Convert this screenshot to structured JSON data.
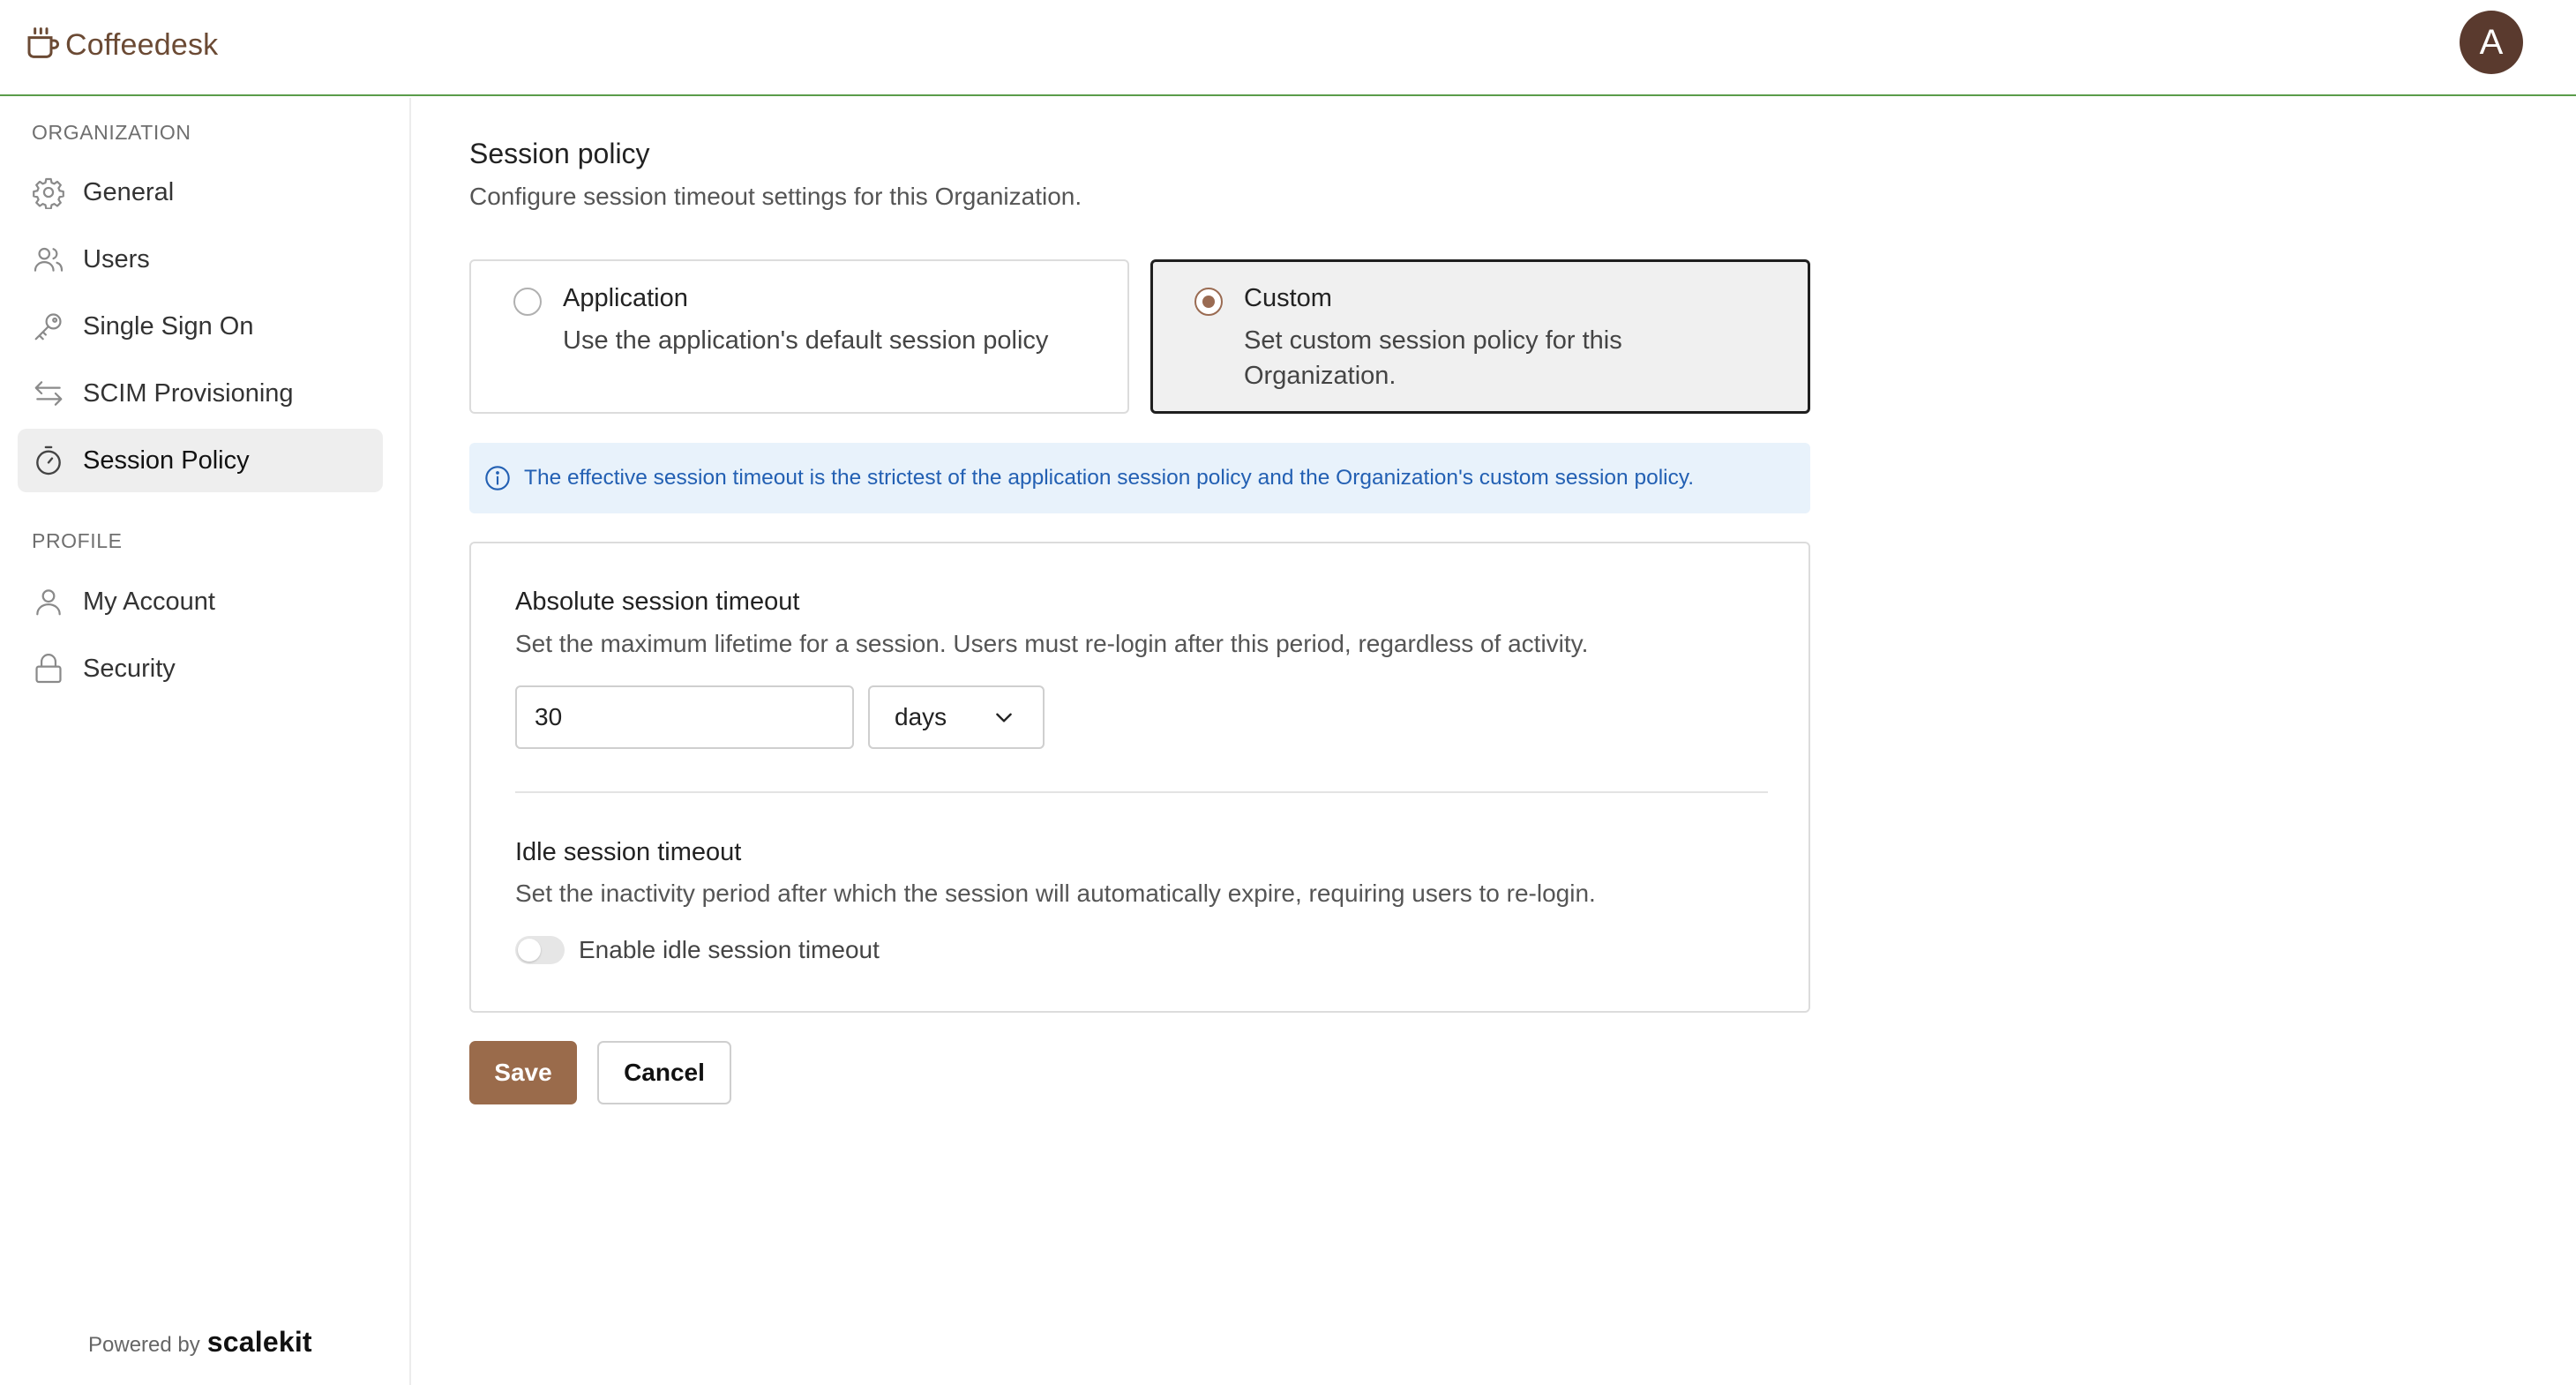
{
  "header": {
    "brand_name": "Coffeedesk",
    "brand_icon": "coffee-cup-icon",
    "avatar_initial": "A"
  },
  "sidebar": {
    "organization_label": "ORGANIZATION",
    "organization_items": [
      {
        "label": "General",
        "icon": "gear-icon"
      },
      {
        "label": "Users",
        "icon": "users-icon"
      },
      {
        "label": "Single Sign On",
        "icon": "key-icon"
      },
      {
        "label": "SCIM Provisioning",
        "icon": "arrows-exchange-icon"
      },
      {
        "label": "Session Policy",
        "icon": "stopwatch-icon",
        "active": true
      }
    ],
    "profile_label": "PROFILE",
    "profile_items": [
      {
        "label": "My Account",
        "icon": "user-icon"
      },
      {
        "label": "Security",
        "icon": "lock-icon"
      }
    ],
    "powered_by": "Powered by",
    "powered_brand": "scalekit"
  },
  "main": {
    "title": "Session policy",
    "subtitle": "Configure session timeout settings for this Organization.",
    "options": [
      {
        "title": "Application",
        "description": "Use the application's default session policy",
        "selected": false
      },
      {
        "title": "Custom",
        "description": "Set custom session policy for this Organization.",
        "selected": true
      }
    ],
    "info_banner": "The effective session timeout is the strictest of the application session policy and the Organization's custom session policy.",
    "absolute": {
      "title": "Absolute session timeout",
      "description": "Set the maximum lifetime for a session. Users must re-login after this period, regardless of activity.",
      "value": "30",
      "unit": "days"
    },
    "idle": {
      "title": "Idle session timeout",
      "description": "Set the inactivity period after which the session will automatically expire, requiring users to re-login.",
      "toggle_label": "Enable idle session timeout",
      "enabled": false
    },
    "save_label": "Save",
    "cancel_label": "Cancel"
  },
  "colors": {
    "accent": "#9a6b4b",
    "header_border": "#5a9c4a",
    "info_text": "#2360b3",
    "info_bg": "#e8f2fb"
  }
}
